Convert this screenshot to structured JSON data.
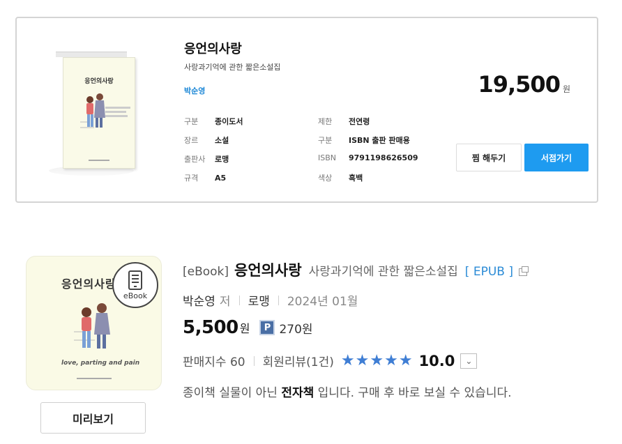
{
  "book": {
    "cover_title": "응언의사랑",
    "title": "응언의사랑",
    "subtitle": "사랑과기억에 관한 짧은소설집",
    "author": "박순영",
    "price": "19,500",
    "currency": "원",
    "specs_left": [
      {
        "label": "구분",
        "value": "종이도서"
      },
      {
        "label": "장르",
        "value": "소설"
      },
      {
        "label": "출판사",
        "value": "로맹"
      },
      {
        "label": "규격",
        "value": "A5"
      }
    ],
    "specs_right": [
      {
        "label": "제한",
        "value": "전연령"
      },
      {
        "label": "구분",
        "value": "ISBN 출판 판매용"
      },
      {
        "label": "ISBN",
        "value": "9791198626509"
      },
      {
        "label": "색상",
        "value": "흑백"
      }
    ],
    "wish_button": "찜 해두기",
    "store_button": "서점가기"
  },
  "ebook": {
    "cover_title": "응언의사랑",
    "cover_tagline": "love, parting and pain",
    "badge_label": "eBook",
    "preview_button": "미리보기",
    "prefix": "[eBook]",
    "title": "응언의사랑",
    "subtitle": "사랑과기억에 관한 짧은소설집",
    "format": "[ EPUB ]",
    "author": "박순영",
    "author_suffix": "저",
    "publisher": "로맹",
    "date": "2024년 01월",
    "price": "5,500",
    "currency": "원",
    "point_badge": "P",
    "points": "270원",
    "sales_index": "판매지수 60",
    "reviews": "회원리뷰(1건)",
    "rating_stars": 5,
    "rating": "10.0",
    "note_pre": "종이책 실물이 아닌 ",
    "note_bold": "전자책",
    "note_post": " 입니다. 구매 후 바로 보실 수 있습니다."
  },
  "colors": {
    "accent": "#1e9bf0",
    "link": "#1a86d6",
    "star": "#3f7ed4"
  }
}
